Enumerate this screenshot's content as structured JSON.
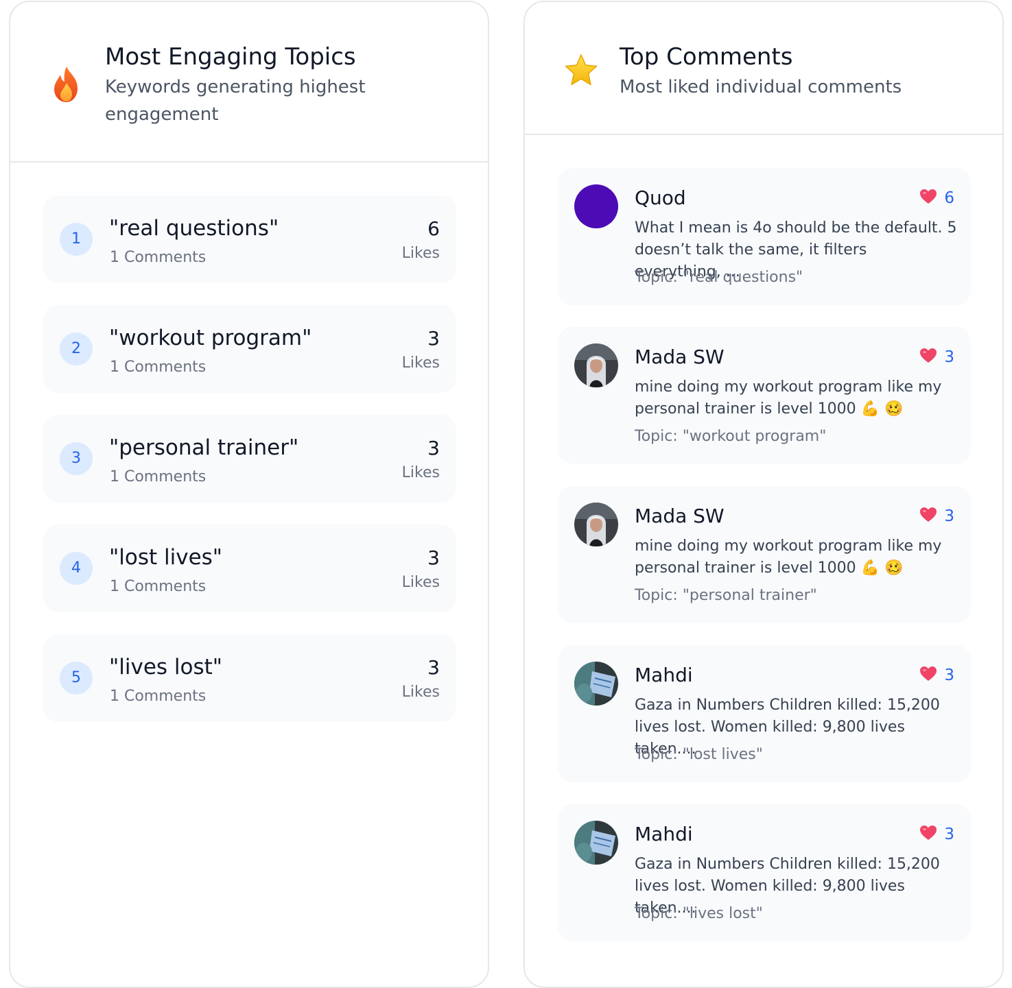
{
  "topics_panel": {
    "title": "Most Engaging Topics",
    "subtitle": "Keywords generating highest engagement",
    "icon": "fire-icon",
    "likes_label": "Likes",
    "items": [
      {
        "rank": "1",
        "keyword": "\"real questions\"",
        "comments": "1 Comments",
        "likes": "6"
      },
      {
        "rank": "2",
        "keyword": "\"workout program\"",
        "comments": "1 Comments",
        "likes": "3"
      },
      {
        "rank": "3",
        "keyword": "\"personal trainer\"",
        "comments": "1 Comments",
        "likes": "3"
      },
      {
        "rank": "4",
        "keyword": "\"lost lives\"",
        "comments": "1 Comments",
        "likes": "3"
      },
      {
        "rank": "5",
        "keyword": "\"lives lost\"",
        "comments": "1 Comments",
        "likes": "3"
      }
    ]
  },
  "comments_panel": {
    "title": "Top Comments",
    "subtitle": "Most liked individual comments",
    "icon": "star-icon",
    "items": [
      {
        "author": "Quod",
        "likes": "6",
        "text": "What I mean is 4o should be the default. 5 doesn’t talk the same, it filters everything, ...",
        "topic": "Topic: \"real questions\""
      },
      {
        "author": "Mada SW",
        "likes": "3",
        "text": "mine doing my workout program like my personal trainer is level 1000 💪 🥴",
        "topic": "Topic: \"workout program\""
      },
      {
        "author": "Mada SW",
        "likes": "3",
        "text": "mine doing my workout program like my personal trainer is level 1000 💪 🥴",
        "topic": "Topic: \"personal trainer\""
      },
      {
        "author": "Mahdi",
        "likes": "3",
        "text": "Gaza in Numbers Children killed: 15,200 lives lost. Women killed: 9,800 lives taken....",
        "topic": "Topic: \"lost lives\""
      },
      {
        "author": "Mahdi",
        "likes": "3",
        "text": "Gaza in Numbers Children killed: 15,200 lives lost. Women killed: 9,800 lives taken....",
        "topic": "Topic: \"lives lost\""
      }
    ]
  },
  "colors": {
    "accent_blue": "#2563eb",
    "badge_bg": "#dbeafe",
    "card_bg": "#f8fafc",
    "heart_red": "#ef4466",
    "avatar_purple": "#4c0bb5"
  }
}
